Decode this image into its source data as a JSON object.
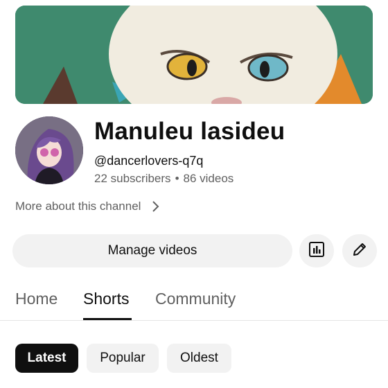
{
  "channel": {
    "name": "Manuleu lasideu",
    "handle": "@dancerlovers-q7q",
    "subscribers": "22 subscribers",
    "separator": "•",
    "videos": "86 videos",
    "more_about": "More about this channel"
  },
  "actions": {
    "manage_videos": "Manage videos"
  },
  "tabs": [
    {
      "label": "Home"
    },
    {
      "label": "Shorts"
    },
    {
      "label": "Community"
    }
  ],
  "active_tab": "Shorts",
  "chips": [
    {
      "label": "Latest"
    },
    {
      "label": "Popular"
    },
    {
      "label": "Oldest"
    }
  ],
  "active_chip": "Latest",
  "icons": {
    "chevron": "chevron-right-icon",
    "stats": "analytics-icon",
    "edit": "pencil-icon"
  },
  "colors": {
    "text": "#0f0f0f",
    "secondary": "#606060",
    "chip_bg": "#f2f2f2",
    "active_chip_bg": "#0f0f0f",
    "banner_bg": "#3f8a6e"
  }
}
